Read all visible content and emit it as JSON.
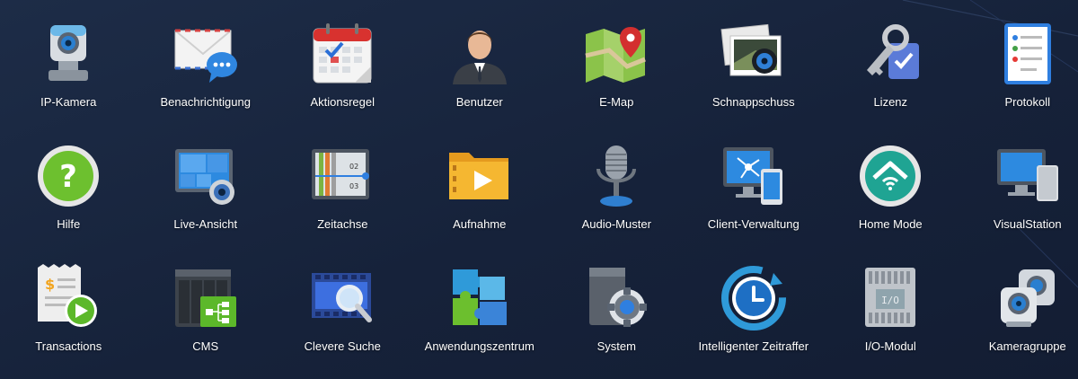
{
  "apps": [
    {
      "label": "IP-Kamera",
      "icon": "ip-camera-icon"
    },
    {
      "label": "Benachrichtigung",
      "icon": "notification-envelope-icon"
    },
    {
      "label": "Aktionsregel",
      "icon": "calendar-rule-icon"
    },
    {
      "label": "Benutzer",
      "icon": "user-icon"
    },
    {
      "label": "E-Map",
      "icon": "map-pin-icon"
    },
    {
      "label": "Schnappschuss",
      "icon": "snapshot-icon"
    },
    {
      "label": "Lizenz",
      "icon": "license-key-icon"
    },
    {
      "label": "Protokoll",
      "icon": "log-list-icon"
    },
    {
      "label": "Hilfe",
      "icon": "help-icon"
    },
    {
      "label": "Live-Ansicht",
      "icon": "live-view-icon"
    },
    {
      "label": "Zeitachse",
      "icon": "timeline-icon"
    },
    {
      "label": "Aufnahme",
      "icon": "recording-folder-icon"
    },
    {
      "label": "Audio-Muster",
      "icon": "microphone-icon"
    },
    {
      "label": "Client-Verwaltung",
      "icon": "client-devices-icon"
    },
    {
      "label": "Home Mode",
      "icon": "home-mode-icon"
    },
    {
      "label": "VisualStation",
      "icon": "visualstation-icon"
    },
    {
      "label": "Transactions",
      "icon": "transactions-icon"
    },
    {
      "label": "CMS",
      "icon": "cms-icon"
    },
    {
      "label": "Clevere Suche",
      "icon": "smart-search-icon"
    },
    {
      "label": "Anwendungszentrum",
      "icon": "puzzle-icon"
    },
    {
      "label": "System",
      "icon": "system-gear-icon"
    },
    {
      "label": "Intelligenter Zeitraffer",
      "icon": "time-lapse-icon"
    },
    {
      "label": "I/O-Modul",
      "icon": "io-module-icon"
    },
    {
      "label": "Kameragruppe",
      "icon": "camera-group-icon"
    }
  ]
}
